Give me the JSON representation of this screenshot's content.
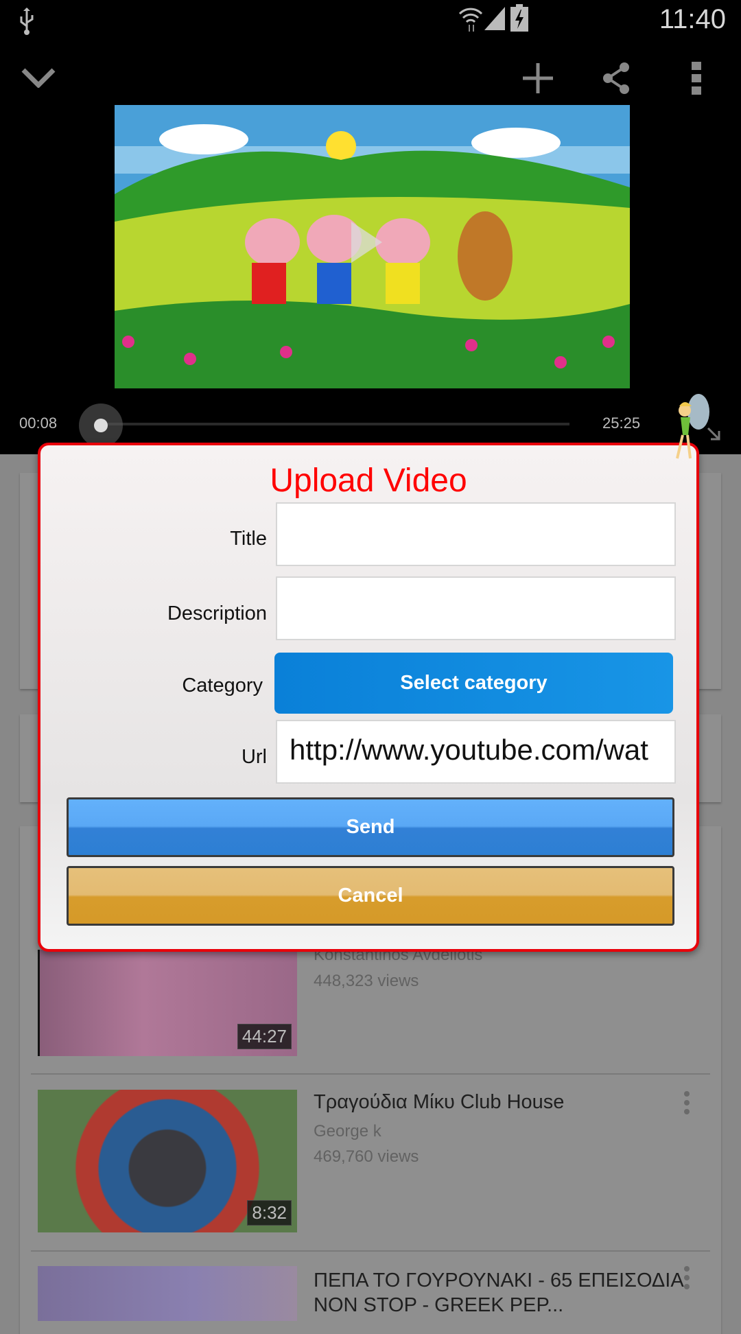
{
  "status_bar": {
    "time": "11:40",
    "icons": [
      "usb-icon",
      "wifi-icon",
      "signal-icon",
      "battery-charging-icon"
    ]
  },
  "action_bar": {
    "icons": [
      "chevron-down-icon",
      "add-icon",
      "share-icon",
      "more-vert-icon"
    ]
  },
  "player": {
    "elapsed": "00:08",
    "duration": "25:25",
    "progress": 0.005
  },
  "dialog": {
    "title": "Upload Video",
    "fields": {
      "title_label": "Title",
      "title_value": "",
      "description_label": "Description",
      "description_value": "",
      "category_label": "Category",
      "category_button": "Select category",
      "url_label": "Url",
      "url_value": "http://www.youtube.com/wat"
    },
    "send": "Send",
    "cancel": "Cancel",
    "colors": {
      "title": "#ff0000",
      "border": "#e8000a",
      "category": "#0a80d8",
      "send": "#3d8fe0",
      "cancel": "#d9a030"
    }
  },
  "videos": [
    {
      "title": "",
      "channel": "Konstantinos Avdeliotis",
      "views": "448,323 views",
      "duration": "44:27"
    },
    {
      "title": "Τραγούδια Μίκυ Club House",
      "channel": "George k",
      "views": "469,760 views",
      "duration": "8:32"
    },
    {
      "title": "ΠΕΠΑ ΤΟ ΓΟΥΡΟΥΝΑΚΙ - 65 ΕΠΕΙΣΟΔΙΑ NON STOP - GREEK PEP...",
      "channel": "",
      "views": "",
      "duration": ""
    }
  ]
}
